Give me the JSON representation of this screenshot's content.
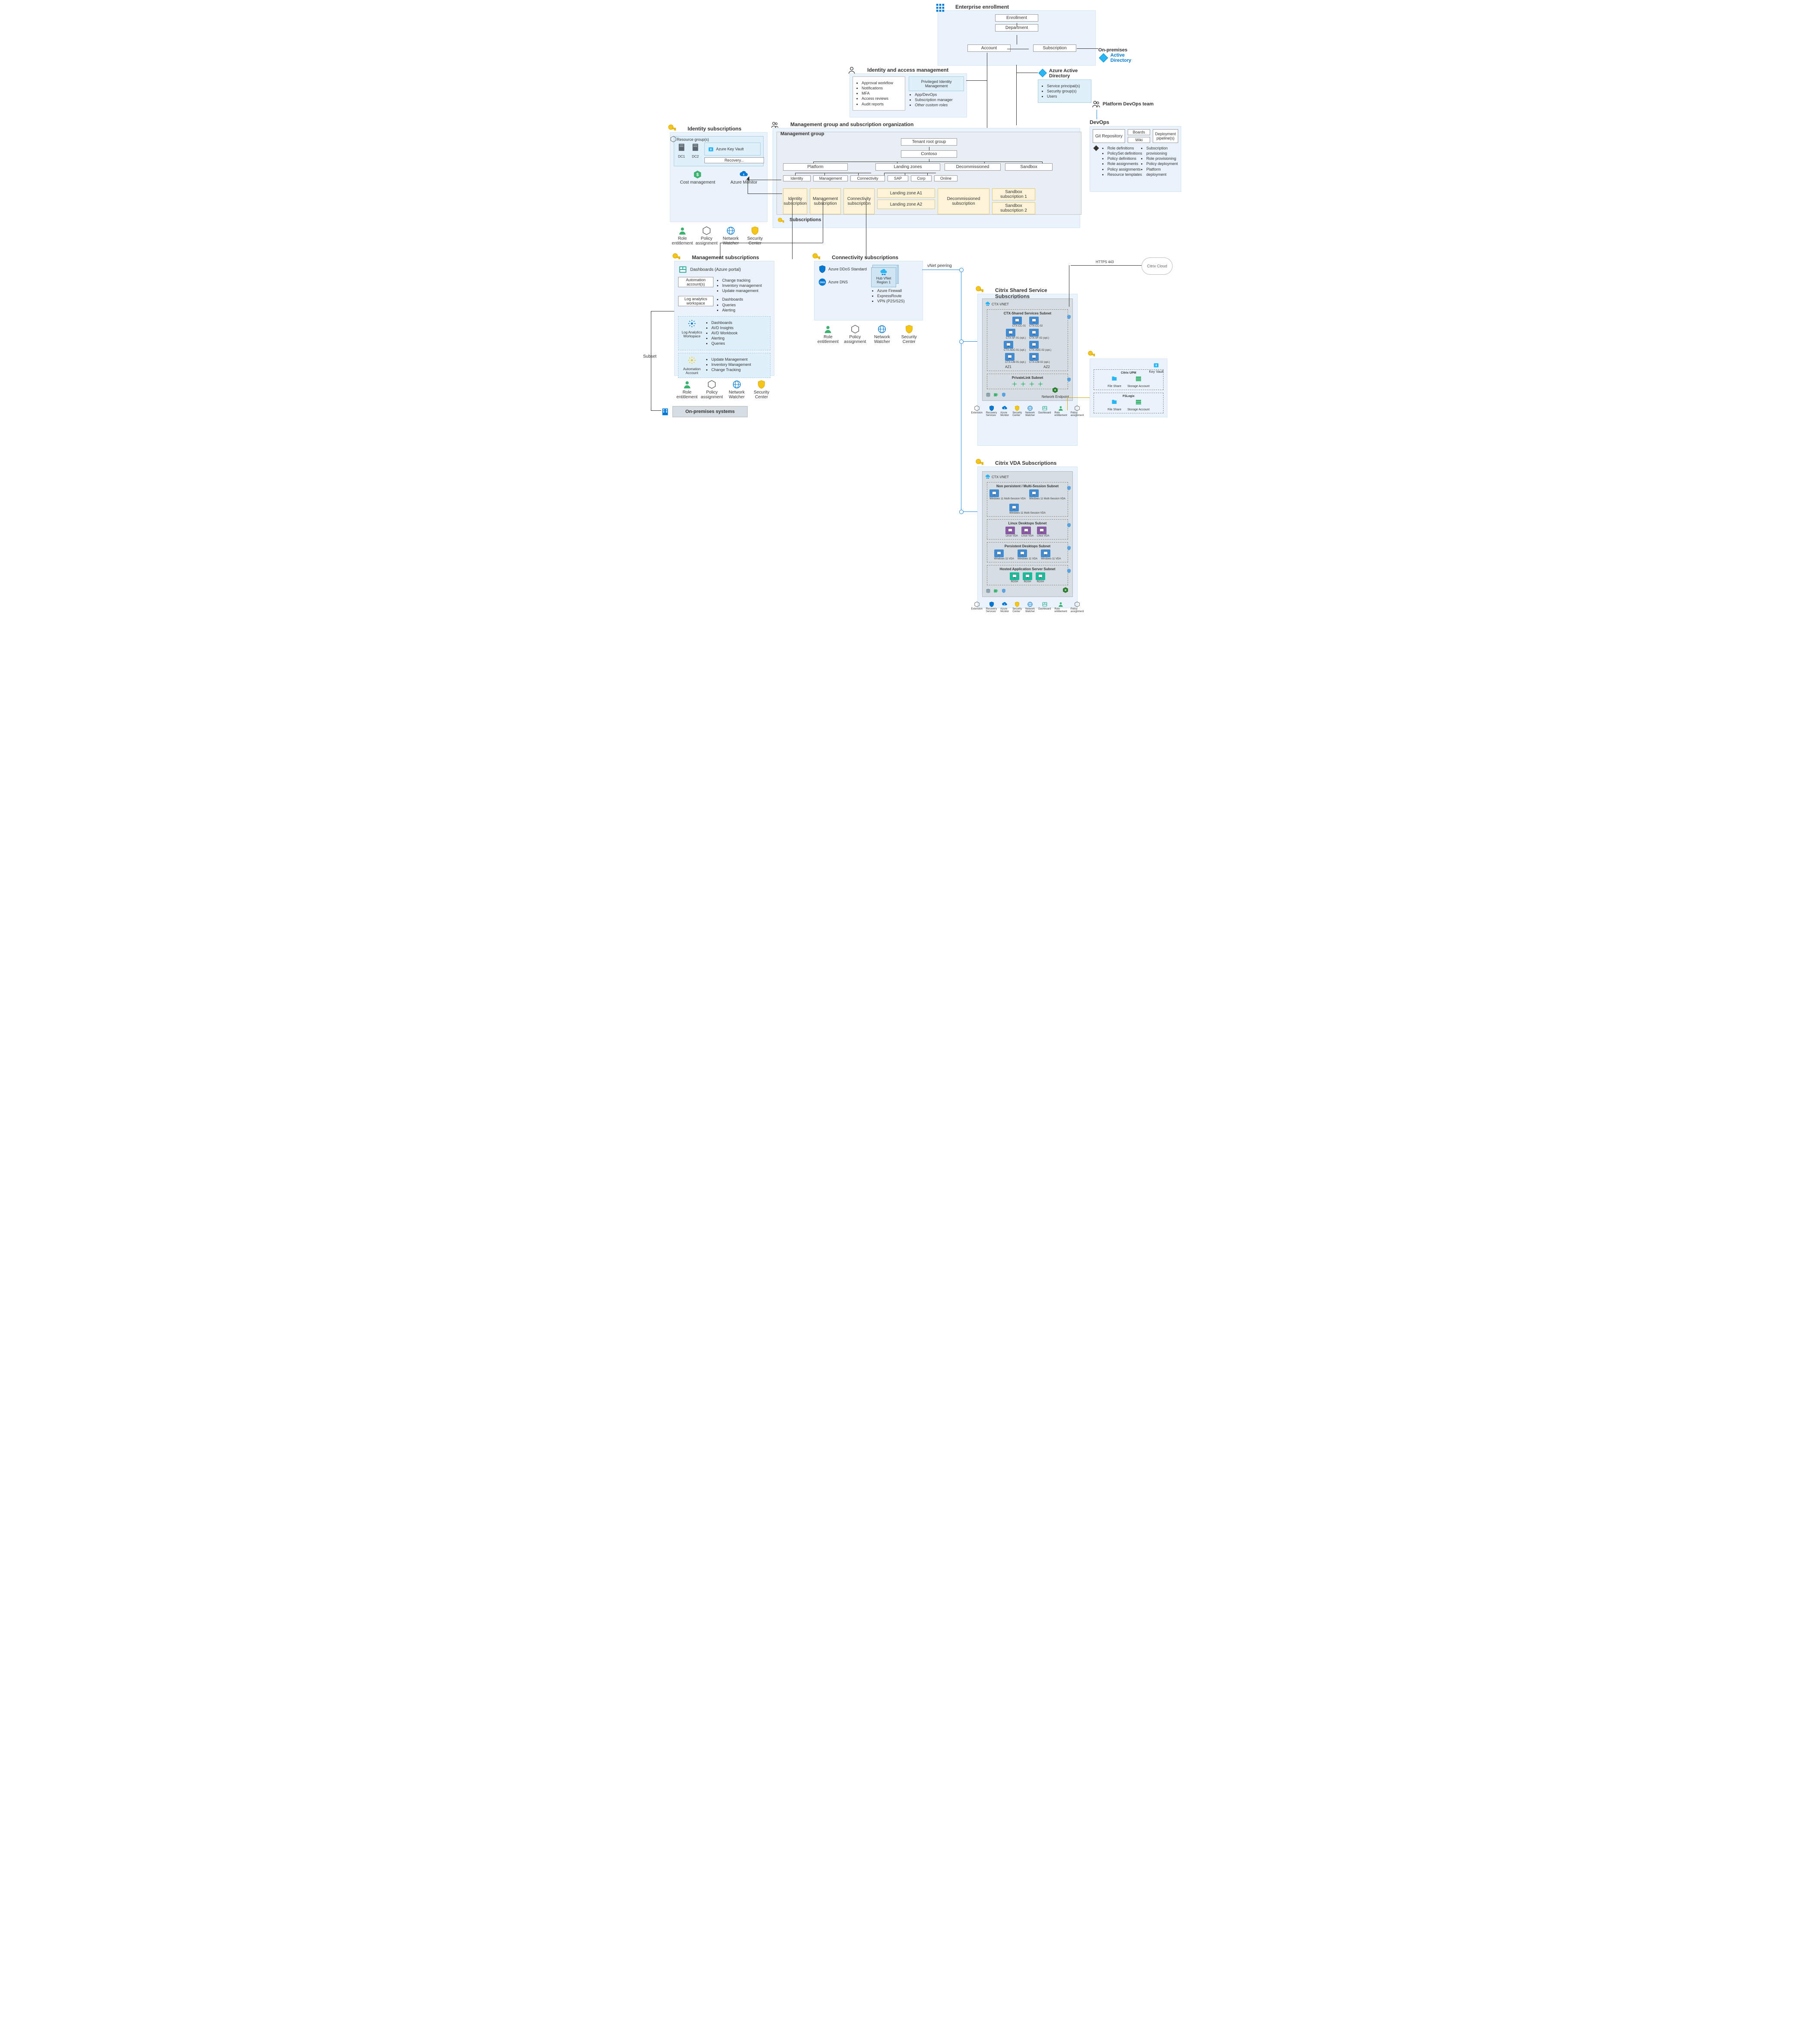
{
  "enterprise": {
    "title": "Enterprise enrollment",
    "nodes": {
      "enroll": "Enrollment",
      "dept": "Department",
      "account": "Account",
      "sub": "Subscription"
    }
  },
  "onprem_ad": {
    "title": "On-premises",
    "line1": "Active",
    "line2": "Directory"
  },
  "aad": {
    "title1": "Azure Active",
    "title2": "Directory",
    "items": [
      "Service principal(s)",
      "Security group(s)",
      "Users"
    ]
  },
  "iam": {
    "title": "Identity and access management",
    "left": [
      "Approval workflow",
      "Notifications",
      "MFA",
      "Access reviews",
      "Audit reports"
    ],
    "pim": "Privileged Identity Management",
    "pim_items": [
      "App/DevOps",
      "Subscription manager",
      "Other custom roles"
    ]
  },
  "devops": {
    "platform_team": "Platform DevOps team",
    "devops": "DevOps",
    "git": "Git Repository",
    "boards": "Boards",
    "wiki": "Wiki",
    "pipe": "Deployment pipeline(s)",
    "repo_items": [
      "Role definitions",
      "PolicySet definitions",
      "Policy definitions",
      "Role assignments",
      "Policy assignments",
      "Resource templates"
    ],
    "pipe_items": [
      "Subscription provisioning",
      "Role provisioning",
      "Policy deployment",
      "Platform deployment"
    ]
  },
  "mgso": {
    "title": "Management group and subscription organization",
    "mg_title": "Management group",
    "tenant": "Tenant root group",
    "contoso": "Contoso",
    "platform": "Platform",
    "lz": "Landing zones",
    "decom": "Decommissioned",
    "sandbox": "Sandbox",
    "identity": "Identity",
    "mgmt": "Management",
    "conn": "Connectivity",
    "sap": "SAP",
    "corp": "Corp",
    "online": "Online",
    "subs_title": "Subscriptions",
    "subs": {
      "identity": "Identity subscription",
      "mgmt": "Management subscription",
      "conn": "Connectivity subscription",
      "lzA1": "Landing zone A1",
      "lzA2": "Landing zone A2",
      "decom": "Decommissioned subscription",
      "sb1": "Sandbox subscription 1",
      "sb2": "Sandbox subscription 2"
    }
  },
  "identity": {
    "title": "Identity subscriptions",
    "rg": "Resource group(s)",
    "dc1": "DC1",
    "dc2": "DC2",
    "kv": "Azure Key Vault",
    "rec": "Recovery...",
    "cost": "Cost management",
    "mon": "Azure Monitor"
  },
  "svc": {
    "role": "Role entitlement",
    "policy": "Policy assignment",
    "nw": "Network Watcher",
    "sc": "Security Center"
  },
  "mgmtsubs": {
    "title": "Management subscriptions",
    "dash": "Dashboards (Azure portal)",
    "auto": "Automation account(s)",
    "auto_items": [
      "Change tracking",
      "Inventory management",
      "Update management"
    ],
    "law": "Log analytics workspace",
    "law_items": [
      "Dashboards",
      "Queries",
      "Alerting"
    ],
    "law2": "Log Analytics Workspace",
    "law2_items": [
      "Dashboards",
      "AVD Insights",
      "AVD Workbook",
      "Alerting",
      "Queries"
    ],
    "auto2": "Automation Account",
    "auto2_items": [
      "Update Management",
      "Inventory Management",
      "Change Tracking"
    ]
  },
  "onprem_sys": "On-premises systems",
  "subset": "Subset",
  "connsubs": {
    "title": "Connectivity subscriptions",
    "ddos": "Azure DDoS Standard",
    "dns": "Azure DNS",
    "hub": "Hub VNet Region 1",
    "hub_items": [
      "Azure Firewall",
      "ExpressRoute",
      "VPN (P2S/S2S)"
    ]
  },
  "vnet_peering": "vNet peering",
  "citrix_cloud": "Citrix Cloud",
  "https": "HTTPS 443",
  "ctx_shared": {
    "title": "Citrix Shared Service Subscriptions",
    "vnet": "CTX-VNET",
    "subnet1": "CTX-Shared Services Subnet",
    "vms": [
      "CTX-CC-01",
      "CTX-CC-02",
      "CTX-SF-01 (opt.)",
      "CTX-SF-02 (opt.)",
      "CTX-ADC-01 (opt.)",
      "CTX-ADC-02 (opt.)",
      "CTX-CM-01 (opt.)",
      "CTX-CM-02 (opt.)"
    ],
    "az1": "AZ1",
    "az2": "AZ2",
    "pl": "PrivateLink Subnet",
    "net_endpoint": "Network Endpoint",
    "keyvault": "Key Vault",
    "upm": "Citrix UPM",
    "fslogix": "FSLogix",
    "fs": "File Share",
    "sa": "Storage Account"
  },
  "ctx_vda": {
    "title": "Citrix VDA Subscriptions",
    "vnet": "CTX-VNET",
    "subnets": {
      "np": "Non persistent / Multi-Session Subnet",
      "np_vms": [
        "Windows 11 Multi-Session VDA",
        "Windows 11 Multi-Session VDA",
        "Windows 11 Multi-Session VDA"
      ],
      "linux": "Linux Desktops Subnet",
      "linux_vms": [
        "Linux VDA",
        "Linux VDA",
        "Linux VDA"
      ],
      "pers": "Persistent Desktops Subnet",
      "pers_vms": [
        "Windows 11 VDA",
        "Windows 11 VDA",
        "Windows 11 VDA"
      ],
      "has": "Hosted Application Server Subnet",
      "has_vms": [
        "RDSH",
        "RDSH",
        "RDSH"
      ]
    }
  },
  "footer_icons": [
    "Extension",
    "Recovery Services",
    "Azure Monitor",
    "Security Center",
    "Network Watcher",
    "Dashboard",
    "Role entitlement",
    "Policy assignment"
  ]
}
